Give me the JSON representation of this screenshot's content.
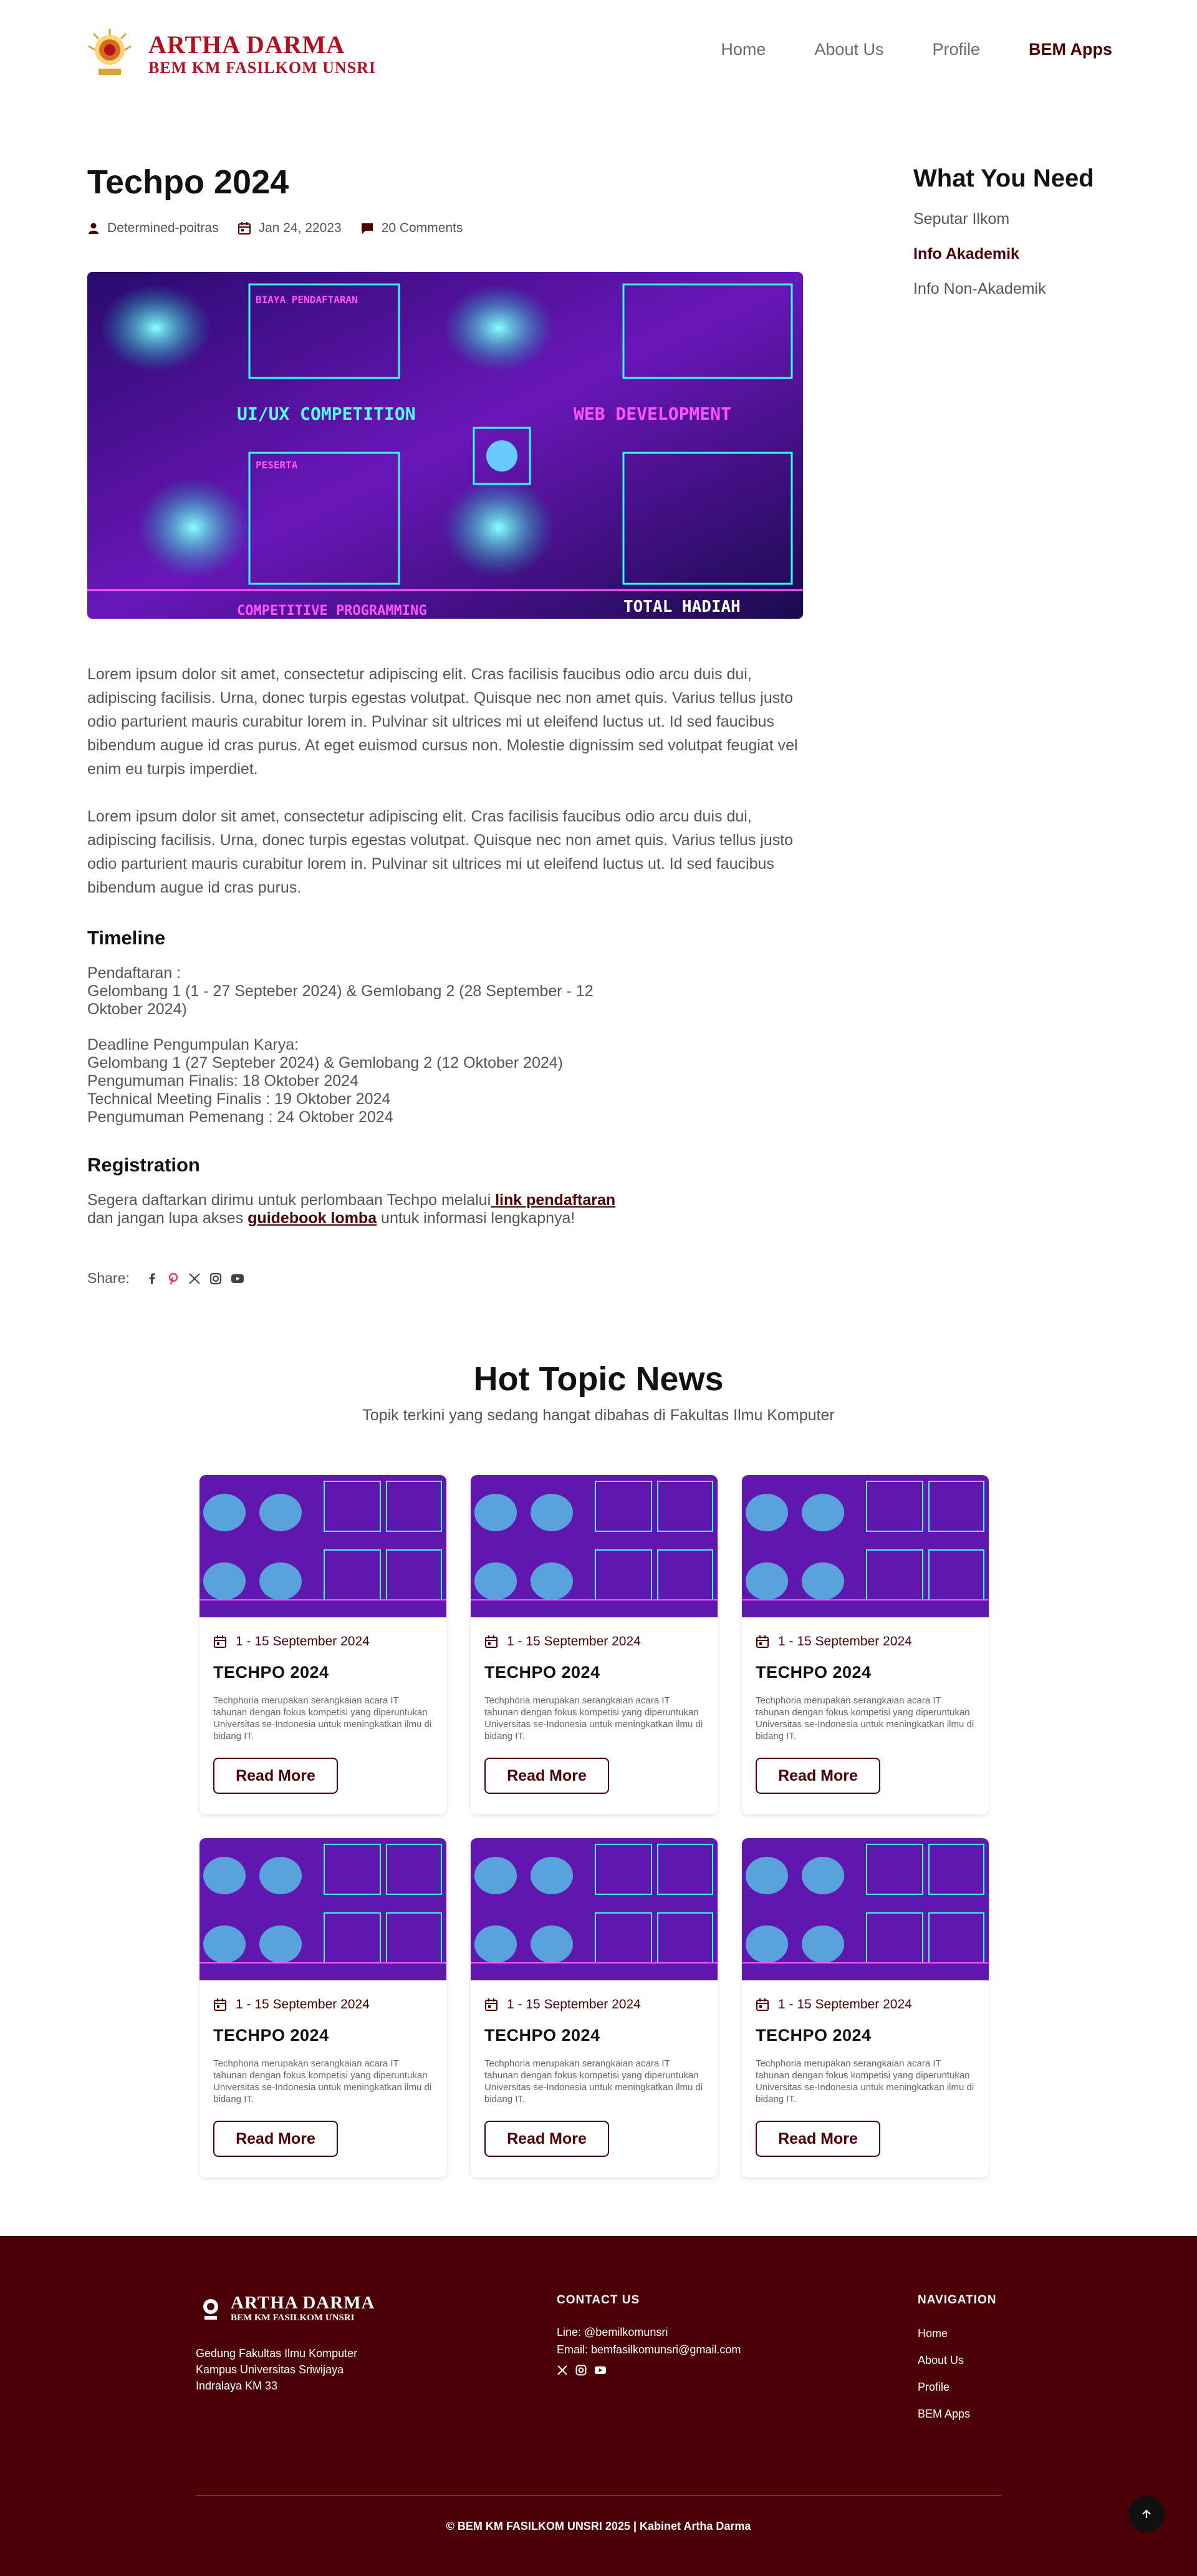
{
  "header": {
    "logo_title": "ARTHA DARMA",
    "logo_subtitle": "BEM KM FASILKOM UNSRI",
    "nav": [
      {
        "label": "Home"
      },
      {
        "label": "About Us"
      },
      {
        "label": "Profile"
      },
      {
        "label": "BEM Apps",
        "active": true
      }
    ]
  },
  "article": {
    "title": "Techpo 2024",
    "author": "Determined-poitras",
    "date": "Jan 24, 22023",
    "comments": "20 Comments",
    "paragraphs": [
      "Lorem ipsum dolor sit amet, consectetur adipiscing elit. Cras facilisis faucibus odio arcu duis dui, adipiscing facilisis. Urna, donec turpis egestas volutpat. Quisque nec non amet quis. Varius tellus justo odio parturient mauris curabitur lorem in. Pulvinar sit ultrices mi ut eleifend luctus ut. Id sed faucibus bibendum augue id cras purus. At eget euismod cursus non. Molestie dignissim sed volutpat feugiat vel enim eu turpis imperdiet.",
      "Lorem ipsum dolor sit amet, consectetur adipiscing elit. Cras facilisis faucibus odio arcu duis dui, adipiscing facilisis. Urna, donec turpis egestas volutpat. Quisque nec non amet quis. Varius tellus justo odio parturient mauris curabitur lorem in. Pulvinar sit ultrices mi ut eleifend luctus ut. Id sed faucibus bibendum augue id cras purus."
    ],
    "timeline_heading": "Timeline",
    "timeline_lines_1": [
      "Pendaftaran :",
      "Gelombang 1  (1 - 27 Septeber 2024) & Gemlobang 2 (28 September - 12",
      "Oktober 2024)"
    ],
    "timeline_lines_2": [
      "Deadline Pengumpulan Karya:",
      "Gelombang 1  (27 Septeber 2024) & Gemlobang 2 (12 Oktober 2024)",
      "Pengumuman Finalis: 18 Oktober 2024",
      "Technical Meeting Finalis : 19 Oktober 2024",
      "Pengumuman Pemenang : 24 Oktober 2024"
    ],
    "registration_heading": "Registration",
    "registration_prefix": "Segera daftarkan dirimu untuk perlombaan Techpo melalui",
    "registration_link": " link pendaftaran",
    "registration_mid": "dan jangan lupa akses ",
    "guidebook_link": "guidebook lomba",
    "registration_suffix": " untuk informasi lengkapnya!",
    "share_label": "Share:",
    "hero_texts": {
      "t1": "UI/UX COMPETITION",
      "t2": "WEB DEVELOPMENT",
      "t3": "BIAYA PENDAFTARAN",
      "t4": "PESERTA",
      "t5": "COMPETITIVE PROGRAMMING",
      "t6": "TOTAL HADIAH"
    }
  },
  "sidebar": {
    "title": "What You Need",
    "items": [
      {
        "label": "Seputar Ilkom"
      },
      {
        "label": "Info Akademik",
        "active": true
      },
      {
        "label": "Info Non-Akademik"
      }
    ]
  },
  "hot": {
    "title": "Hot Topic News",
    "subtitle": "Topik terkini yang sedang hangat dibahas di Fakultas Ilmu Komputer",
    "cards": [
      {
        "date": "1 - 15 September 2024",
        "title": "TECHPO 2024",
        "desc": "Techphoria merupakan serangkaian acara IT tahunan dengan fokus kompetisi yang diperuntukan Universitas se-Indonesia untuk meningkatkan ilmu di bidang IT.",
        "button": "Read More"
      },
      {
        "date": "1 - 15 September 2024",
        "title": "TECHPO 2024",
        "desc": "Techphoria merupakan serangkaian acara IT tahunan dengan fokus kompetisi yang diperuntukan Universitas se-Indonesia untuk meningkatkan ilmu di bidang IT.",
        "button": "Read More"
      },
      {
        "date": "1 - 15 September 2024",
        "title": "TECHPO 2024",
        "desc": "Techphoria merupakan serangkaian acara IT tahunan dengan fokus kompetisi yang diperuntukan Universitas se-Indonesia untuk meningkatkan ilmu di bidang IT.",
        "button": "Read More"
      },
      {
        "date": "1 - 15 September 2024",
        "title": "TECHPO 2024",
        "desc": "Techphoria merupakan serangkaian acara IT tahunan dengan fokus kompetisi yang diperuntukan Universitas se-Indonesia untuk meningkatkan ilmu di bidang IT.",
        "button": "Read More"
      },
      {
        "date": "1 - 15 September 2024",
        "title": "TECHPO 2024",
        "desc": "Techphoria merupakan serangkaian acara IT tahunan dengan fokus kompetisi yang diperuntukan Universitas se-Indonesia untuk meningkatkan ilmu di bidang IT.",
        "button": "Read More"
      },
      {
        "date": "1 - 15 September 2024",
        "title": "TECHPO 2024",
        "desc": "Techphoria merupakan serangkaian acara IT tahunan dengan fokus kompetisi yang diperuntukan Universitas se-Indonesia untuk meningkatkan ilmu di bidang IT.",
        "button": "Read More"
      }
    ]
  },
  "footer": {
    "logo_title": "ARTHA DARMA",
    "logo_subtitle": "BEM KM FASILKOM UNSRI",
    "address": [
      "Gedung Fakultas Ilmu Komputer",
      "Kampus Universitas Sriwijaya",
      "Indralaya KM 33"
    ],
    "contact_heading": "CONTACT US",
    "contact_line": "Line: @bemilkomunsri",
    "contact_email": "Email: bemfasilkomunsri@gmail.com",
    "nav_heading": "NAVIGATION",
    "nav_links": [
      {
        "label": "Home"
      },
      {
        "label": "About Us"
      },
      {
        "label": "Profile"
      },
      {
        "label": "BEM Apps"
      }
    ],
    "copyright": "© BEM KM FASILKOM UNSRI 2025 | Kabinet Artha Darma"
  },
  "colors": {
    "brand": "#4a0004",
    "logo_red": "#b01020",
    "footer_bg": "#4a0004"
  },
  "icons": [
    "user-icon",
    "calendar-icon",
    "comment-icon",
    "facebook-icon",
    "pinterest-icon",
    "x-icon",
    "instagram-icon",
    "youtube-icon",
    "arrow-up-icon"
  ]
}
